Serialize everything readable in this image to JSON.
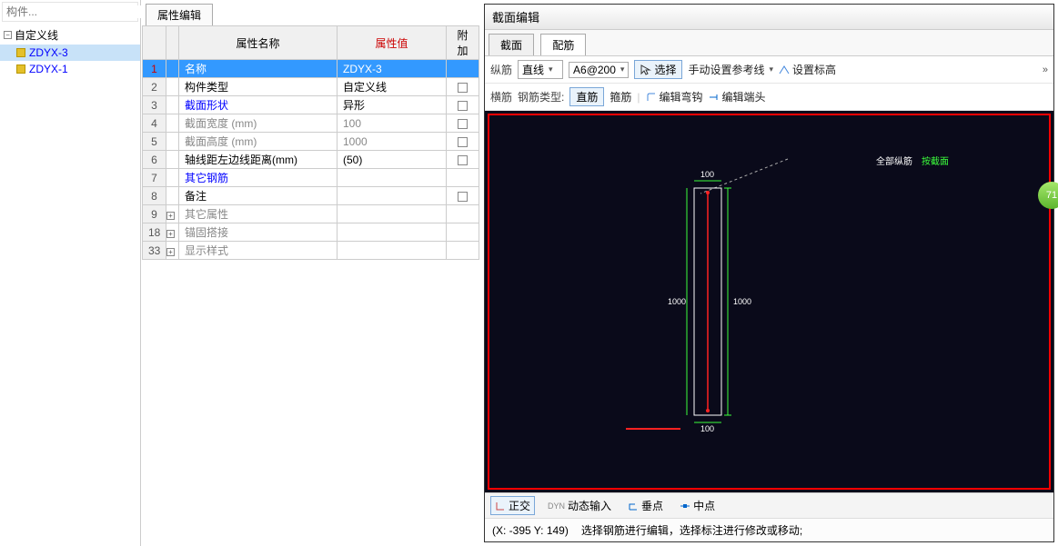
{
  "sidebar": {
    "search_placeholder": "构件...",
    "root": "自定义线",
    "items": [
      "ZDYX-3",
      "ZDYX-1"
    ],
    "selected_index": 0
  },
  "mid": {
    "tab": "属性编辑",
    "headers": {
      "name": "属性名称",
      "value": "属性值",
      "extra": "附加"
    },
    "rows": [
      {
        "idx": "1",
        "name": "名称",
        "value": "ZDYX-3",
        "selected": true,
        "chk": null
      },
      {
        "idx": "2",
        "name": "构件类型",
        "value": "自定义线",
        "chk": false
      },
      {
        "idx": "3",
        "name": "截面形状",
        "value": "异形",
        "blue": true,
        "chk": false
      },
      {
        "idx": "4",
        "name": "截面宽度 (mm)",
        "value": "100",
        "gray": true,
        "chk": false
      },
      {
        "idx": "5",
        "name": "截面高度 (mm)",
        "value": "1000",
        "gray": true,
        "chk": false
      },
      {
        "idx": "6",
        "name": "轴线距左边线距离(mm)",
        "value": "(50)",
        "chk": false
      },
      {
        "idx": "7",
        "name": "其它钢筋",
        "value": "",
        "blue": true,
        "chk": null
      },
      {
        "idx": "8",
        "name": "备注",
        "value": "",
        "chk": false
      },
      {
        "idx": "9",
        "name": "其它属性",
        "value": "",
        "gray": true,
        "expand": true
      },
      {
        "idx": "18",
        "name": "锚固搭接",
        "value": "",
        "gray": true,
        "expand": true
      },
      {
        "idx": "33",
        "name": "显示样式",
        "value": "",
        "gray": true,
        "expand": true
      }
    ]
  },
  "right": {
    "title": "截面编辑",
    "tabs": [
      "截面",
      "配筋"
    ],
    "active_tab": 1,
    "tool1": {
      "label": "纵筋",
      "draw_mode": "直线",
      "rebar_spec": "A6@200",
      "select": "选择",
      "manual": "手动设置参考线",
      "elev": "设置标高"
    },
    "tool2": {
      "label": "横筋",
      "type_label": "钢筋类型:",
      "straight": "直筋",
      "stirrup": "箍筋",
      "edit_hook": "编辑弯钩",
      "edit_end": "编辑端头"
    },
    "legend": {
      "a": "全部纵筋",
      "b": "按截面"
    },
    "dims": {
      "w": "100",
      "h": "1000"
    },
    "status": {
      "ortho": "正交",
      "dynamic": "动态输入",
      "perp": "垂点",
      "mid": "中点"
    },
    "coord": "(X: -395 Y: 149)",
    "hint": "选择钢筋进行编辑，选择标注进行修改或移动;"
  },
  "badge": "71"
}
